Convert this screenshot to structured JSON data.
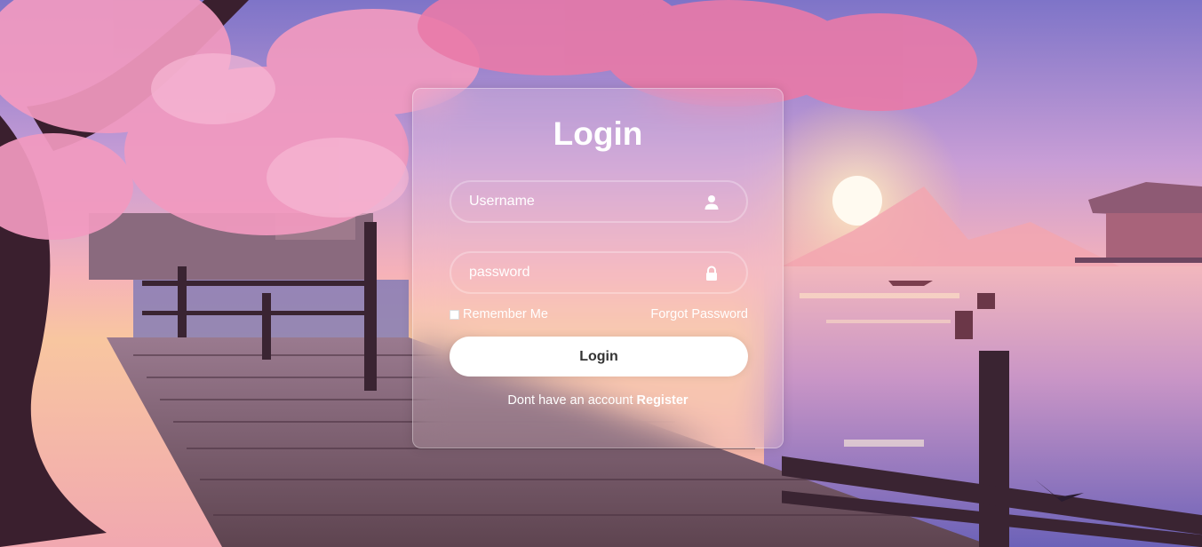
{
  "login": {
    "title": "Login",
    "username_placeholder": "Username",
    "password_placeholder": "password",
    "remember_label": "Remember Me",
    "forgot_label": "Forgot Password",
    "login_button": "Login",
    "register_prompt": "Dont have an account",
    "register_link": "Register"
  },
  "icons": {
    "username": "user-icon",
    "password": "lock-icon"
  },
  "colors": {
    "button_bg": "#ffffff",
    "button_text": "#333333",
    "text": "#ffffff"
  }
}
